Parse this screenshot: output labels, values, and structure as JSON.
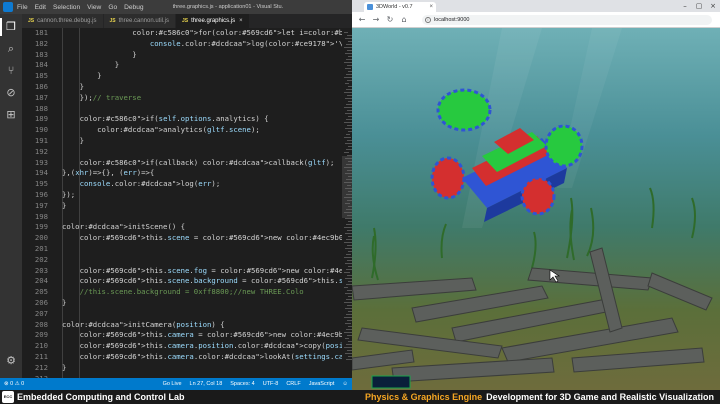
{
  "vscode": {
    "menu": [
      "File",
      "Edit",
      "Selection",
      "View",
      "Go",
      "Debug"
    ],
    "window_title": "three.graphics.js - application01 - Visual Stu...",
    "tabs": [
      {
        "label": "cannon.three.debug.js",
        "active": false
      },
      {
        "label": "three.cannon.util.js",
        "active": false
      },
      {
        "label": "three.graphics.js",
        "active": true
      }
    ],
    "icons": [
      "explorer-icon",
      "search-icon",
      "source-control-icon",
      "debug-icon",
      "extensions-icon",
      "settings-gear-icon"
    ],
    "lines": [
      {
        "n": "181",
        "t": "                for(let i=0; i<group.children.le"
      },
      {
        "n": "182",
        "t": "                    console.log('\\t', group.chi"
      },
      {
        "n": "183",
        "t": "                }"
      },
      {
        "n": "184",
        "t": "            }"
      },
      {
        "n": "185",
        "t": "        }"
      },
      {
        "n": "186",
        "t": "    }"
      },
      {
        "n": "187",
        "t": "    });// traverse"
      },
      {
        "n": "188",
        "t": ""
      },
      {
        "n": "189",
        "t": "    if(self.options.analytics) {"
      },
      {
        "n": "190",
        "t": "        analytics(gltf.scene);"
      },
      {
        "n": "191",
        "t": "    }"
      },
      {
        "n": "192",
        "t": ""
      },
      {
        "n": "193",
        "t": "    if(callback) callback(gltf);"
      },
      {
        "n": "194",
        "t": "},(xhr)=>{}, (err)=>{"
      },
      {
        "n": "195",
        "t": "    console.log(err);"
      },
      {
        "n": "196",
        "t": "});"
      },
      {
        "n": "197",
        "t": "}"
      },
      {
        "n": "198",
        "t": ""
      },
      {
        "n": "199",
        "t": "initScene() {"
      },
      {
        "n": "200",
        "t": "    this.scene = new THREE.Scene();"
      },
      {
        "n": "201",
        "t": ""
      },
      {
        "n": "202",
        "t": ""
      },
      {
        "n": "203",
        "t": "    this.scene.fog = new THREE.Fog( settings.fog.color|"
      },
      {
        "n": "204",
        "t": "    this.scene.background = this.scene.fog.color;"
      },
      {
        "n": "205",
        "t": "    //this.scene.background = 0xff8800;//new THREE.Colo"
      },
      {
        "n": "206",
        "t": "}"
      },
      {
        "n": "207",
        "t": ""
      },
      {
        "n": "208",
        "t": "initCamera(position) {"
      },
      {
        "n": "209",
        "t": "    this.camera = new THREE.PerspectiveCamera(45, window"
      },
      {
        "n": "210",
        "t": "    this.camera.position.copy(position || settings.camer"
      },
      {
        "n": "211",
        "t": "    this.camera.lookAt(settings.camera.lookAt);"
      },
      {
        "n": "212",
        "t": "}"
      },
      {
        "n": "213",
        "t": ""
      }
    ],
    "status": {
      "errors": "⊗ 0 ⚠ 0",
      "golive": "Go Live",
      "position": "Ln 27, Col 18",
      "spaces": "Spaces: 4",
      "encoding": "UTF-8",
      "eol": "CRLF",
      "language": "JavaScript"
    }
  },
  "browser": {
    "tab_title": "3DWorld - v0.7",
    "url": "localhost:9000",
    "icons": [
      "back-icon",
      "forward-icon",
      "reload-icon",
      "home-icon",
      "info-icon"
    ]
  },
  "banner": {
    "logo": "ECC",
    "lab": "Embedded Computing and Control Lab",
    "highlight": "Physics & Graphics Engine",
    "rest": "Development for 3D Game and Realistic Visualization"
  },
  "colors": {
    "accent": "#007acc",
    "keyword": "#569cd6",
    "control": "#c586c0",
    "function": "#dcdcaa",
    "variable": "#9cdcfe",
    "class": "#4ec9b0",
    "comment": "#6a9955",
    "number": "#b5cea8",
    "string": "#ce9178",
    "banner_highlight": "#f5a623"
  }
}
